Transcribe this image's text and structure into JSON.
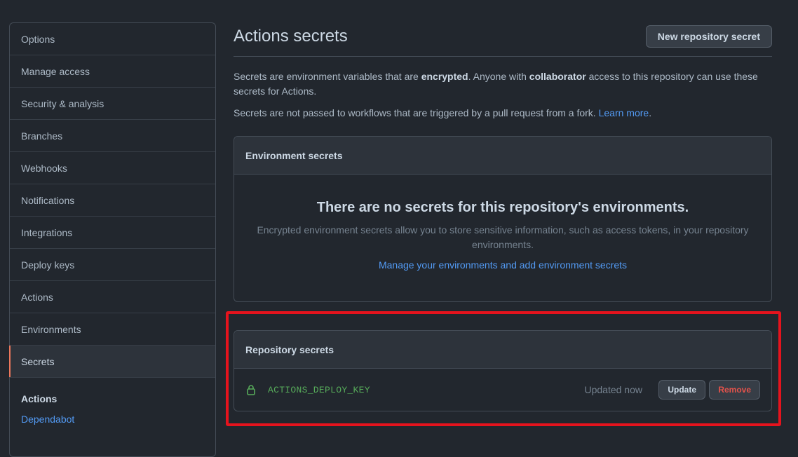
{
  "sidebar": {
    "items": [
      {
        "label": "Options"
      },
      {
        "label": "Manage access"
      },
      {
        "label": "Security & analysis"
      },
      {
        "label": "Branches"
      },
      {
        "label": "Webhooks"
      },
      {
        "label": "Notifications"
      },
      {
        "label": "Integrations"
      },
      {
        "label": "Deploy keys"
      },
      {
        "label": "Actions"
      },
      {
        "label": "Environments"
      },
      {
        "label": "Secrets"
      }
    ],
    "selected": "Secrets",
    "sub_title": "Actions",
    "sub_link": "Dependabot"
  },
  "header": {
    "title": "Actions secrets",
    "new_button": "New repository secret"
  },
  "description": {
    "p1_a": "Secrets are environment variables that are ",
    "p1_b": "encrypted",
    "p1_c": ". Anyone with ",
    "p1_d": "collaborator",
    "p1_e": " access to this repository can use these secrets for Actions.",
    "p2": "Secrets are not passed to workflows that are triggered by a pull request from a fork. ",
    "p2_link": "Learn more",
    "p2_end": "."
  },
  "environment_secrets": {
    "header": "Environment secrets",
    "empty_title": "There are no secrets for this repository's environments.",
    "empty_desc": "Encrypted environment secrets allow you to store sensitive information, such as access tokens, in your repository environments.",
    "manage_link": "Manage your environments and add environment secrets"
  },
  "repository_secrets": {
    "header": "Repository secrets",
    "rows": [
      {
        "icon": "lock-icon",
        "name": "ACTIONS_DEPLOY_KEY",
        "updated": "Updated now",
        "update_label": "Update",
        "remove_label": "Remove"
      }
    ]
  },
  "colors": {
    "background": "#22272e",
    "accent_link": "#539bf5",
    "secret_name": "#57ab5a",
    "remove": "#e5534b",
    "highlight": "#e5131d"
  }
}
